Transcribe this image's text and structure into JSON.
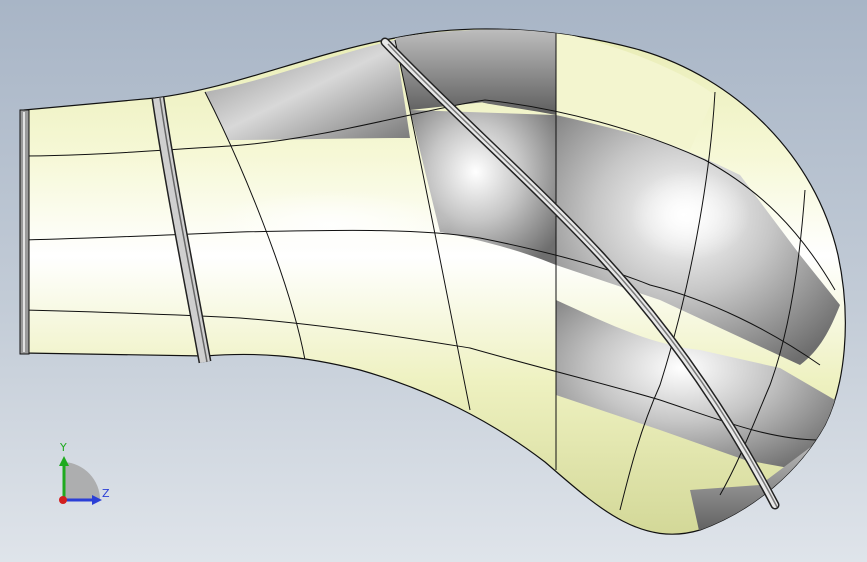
{
  "viewport": {
    "background_top": "#a8b5c6",
    "background_bottom": "#dfe4ea"
  },
  "model": {
    "part": "curved-duct-elbow",
    "shading_colors": {
      "face_light": "#f6f8d6",
      "face_mid": "#e6eab0",
      "face_dark": "#c9ce8c",
      "metal_light": "#f2f2f2",
      "metal_dark": "#6f6f6f",
      "edge": "#111111"
    }
  },
  "triad": {
    "y_label": "Y",
    "z_label": "Z",
    "y_color": "#1faa1f",
    "z_color": "#2b3fd6",
    "x_color": "#d21f1f"
  }
}
